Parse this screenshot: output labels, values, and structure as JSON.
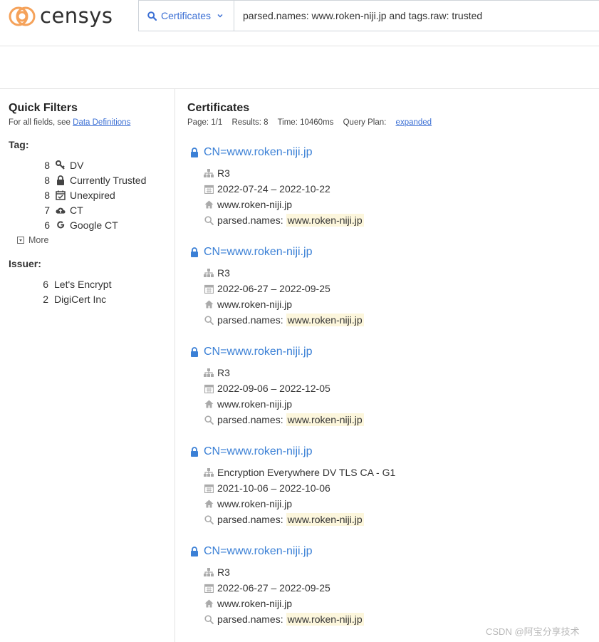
{
  "header": {
    "logo_text": "censys",
    "search_type": "Certificates",
    "query": "parsed.names: www.roken-niji.jp and tags.raw: trusted"
  },
  "sidebar": {
    "title": "Quick Filters",
    "subtitle_prefix": "For all fields, see",
    "subtitle_link": "Data Definitions",
    "tag_label": "Tag:",
    "tags": [
      {
        "count": "8",
        "label": "DV",
        "icon": "key-icon"
      },
      {
        "count": "8",
        "label": "Currently Trusted",
        "icon": "lock-icon"
      },
      {
        "count": "8",
        "label": "Unexpired",
        "icon": "calendar-check-icon"
      },
      {
        "count": "7",
        "label": "CT",
        "icon": "cloud-upload-icon"
      },
      {
        "count": "6",
        "label": "Google CT",
        "icon": "google-icon"
      }
    ],
    "more_label": "More",
    "issuer_label": "Issuer:",
    "issuers": [
      {
        "count": "6",
        "label": "Let's Encrypt"
      },
      {
        "count": "2",
        "label": "DigiCert Inc"
      }
    ]
  },
  "main": {
    "title": "Certificates",
    "page": "Page: 1/1",
    "results": "Results: 8",
    "time": "Time: 10460ms",
    "query_plan_prefix": "Query Plan:",
    "query_plan_link": "expanded",
    "results_list": [
      {
        "title": "CN=www.roken-niji.jp",
        "issuer": "R3",
        "validity": "2022-07-24 – 2022-10-22",
        "domain": "www.roken-niji.jp",
        "match_field": "parsed.names:",
        "match_value": "www.roken-niji.jp"
      },
      {
        "title": "CN=www.roken-niji.jp",
        "issuer": "R3",
        "validity": "2022-06-27 – 2022-09-25",
        "domain": "www.roken-niji.jp",
        "match_field": "parsed.names:",
        "match_value": "www.roken-niji.jp"
      },
      {
        "title": "CN=www.roken-niji.jp",
        "issuer": "R3",
        "validity": "2022-09-06 – 2022-12-05",
        "domain": "www.roken-niji.jp",
        "match_field": "parsed.names:",
        "match_value": "www.roken-niji.jp"
      },
      {
        "title": "CN=www.roken-niji.jp",
        "issuer": "Encryption Everywhere DV TLS CA - G1",
        "validity": "2021-10-06 – 2022-10-06",
        "domain": "www.roken-niji.jp",
        "match_field": "parsed.names:",
        "match_value": "www.roken-niji.jp"
      },
      {
        "title": "CN=www.roken-niji.jp",
        "issuer": "R3",
        "validity": "2022-06-27 – 2022-09-25",
        "domain": "www.roken-niji.jp",
        "match_field": "parsed.names:",
        "match_value": "www.roken-niji.jp"
      }
    ]
  },
  "watermark": "CSDN @阿宝分享技术",
  "colors": {
    "accent": "#3b80d6",
    "logo_orange": "#f5a25a",
    "highlight": "#fcf6dc"
  }
}
